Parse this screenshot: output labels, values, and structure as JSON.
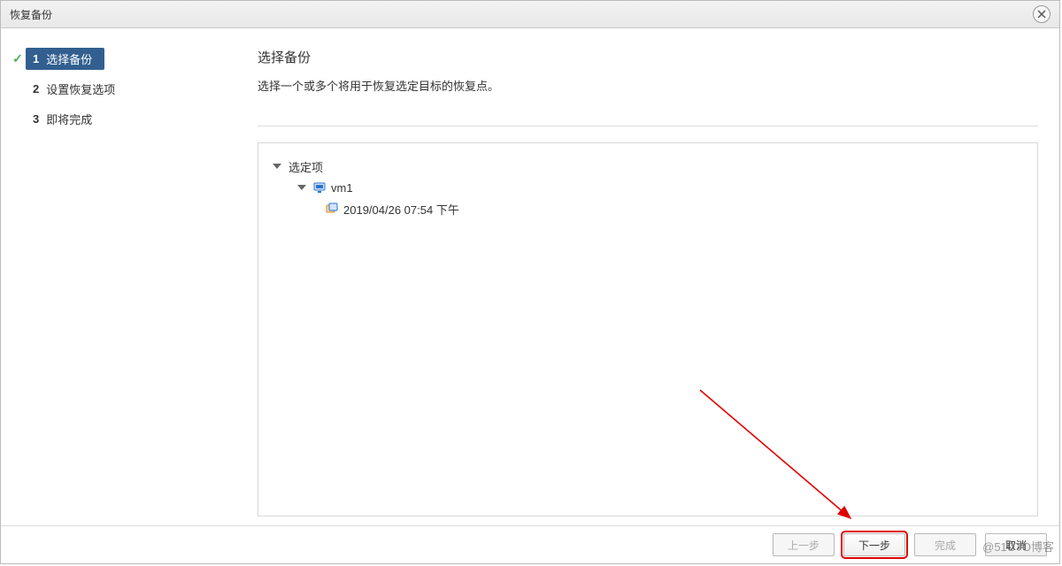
{
  "titlebar": {
    "title": "恢复备份"
  },
  "sidebar": {
    "steps": [
      {
        "num": "1",
        "label": "选择备份",
        "active": true,
        "done": true
      },
      {
        "num": "2",
        "label": "设置恢复选项",
        "active": false,
        "done": false
      },
      {
        "num": "3",
        "label": "即将完成",
        "active": false,
        "done": false
      }
    ]
  },
  "main": {
    "heading": "选择备份",
    "description": "选择一个或多个将用于恢复选定目标的恢复点。",
    "tree": {
      "root_label": "选定项",
      "vm_label": "vm1",
      "snapshot_label": "2019/04/26 07:54 下午"
    }
  },
  "footer": {
    "prev": "上一步",
    "next": "下一步",
    "finish": "完成",
    "cancel": "取消"
  },
  "watermark": "@51CTO博客"
}
